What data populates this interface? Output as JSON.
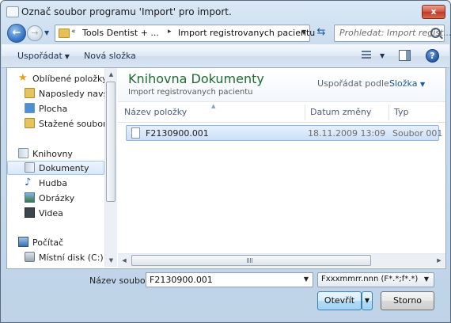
{
  "window": {
    "title": "Označ soubor programu 'Import' pro import.",
    "close_glyph": "x"
  },
  "nav": {
    "back_glyph": "←",
    "forward_glyph": "→",
    "breadcrumb": [
      "Tools Dentist + ...",
      "Import registrovanych pacientu"
    ],
    "search_placeholder": "Prohledat: Import regist..."
  },
  "toolbar": {
    "organize_label": "Uspořádat",
    "new_folder_label": "Nová složka",
    "help_glyph": "?"
  },
  "sidebar": {
    "items": [
      {
        "label": "Oblíbené položky",
        "icon": "star-icon"
      },
      {
        "label": "Naposledy navštív",
        "icon": "recent-places-icon"
      },
      {
        "label": "Plocha",
        "icon": "desktop-icon"
      },
      {
        "label": "Stažené soubory",
        "icon": "downloads-icon"
      },
      {
        "label": "Knihovny",
        "icon": "libraries-icon"
      },
      {
        "label": "Dokumenty",
        "icon": "documents-icon",
        "selected": true
      },
      {
        "label": "Hudba",
        "icon": "music-icon"
      },
      {
        "label": "Obrázky",
        "icon": "pictures-icon"
      },
      {
        "label": "Videa",
        "icon": "videos-icon"
      },
      {
        "label": "Počítač",
        "icon": "computer-icon"
      },
      {
        "label": "Místní disk (C:)",
        "icon": "local-disk-icon"
      }
    ]
  },
  "library": {
    "title": "Knihovna Dokumenty",
    "subtitle": "Import registrovanych pacientu",
    "arrange_label": "Uspořádat podle:",
    "arrange_value": "Složka"
  },
  "columns": {
    "name": "Název položky",
    "date": "Datum změny",
    "type": "Typ"
  },
  "files": [
    {
      "name": "F2130900.001",
      "date": "18.11.2009 13:09",
      "type": "Soubor 001"
    }
  ],
  "footer": {
    "filename_label": "Název souboru:",
    "filename_value": "F2130900.001",
    "filter_value": "Fxxxmmrr.nnn (F*.*;f*.*)",
    "open_label": "Otevřít",
    "cancel_label": "Storno"
  }
}
